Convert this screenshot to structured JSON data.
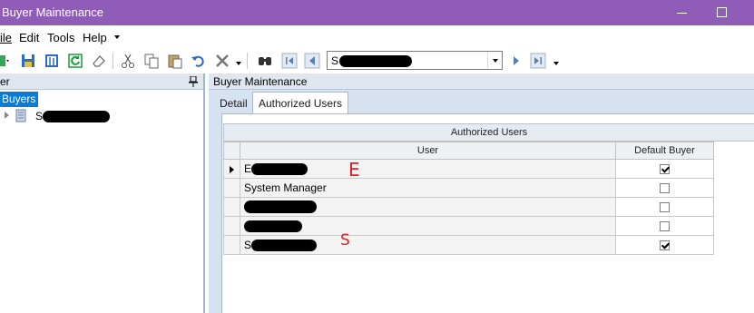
{
  "window": {
    "title": "Buyer Maintenance",
    "minimize_icon": "minimize-icon",
    "maximize_icon": "maximize-icon"
  },
  "menu": {
    "items": [
      {
        "label": "ile",
        "mnemonic": "F"
      },
      {
        "label": "Edit"
      },
      {
        "label": "Tools"
      },
      {
        "label": "Help"
      }
    ]
  },
  "toolbar": {
    "icons": [
      "new-icon",
      "save-icon",
      "attach-icon",
      "refresh-icon",
      "clear-icon",
      "cut-icon",
      "copy-icon",
      "paste-icon",
      "undo-icon",
      "delete-icon",
      "find-icon",
      "first-record-icon",
      "previous-record-icon",
      "next-record-icon",
      "last-record-icon"
    ],
    "navigator_value": "S"
  },
  "tree_panel": {
    "header": "er",
    "root_label": "Buyers",
    "node_label_visible": "S"
  },
  "main_panel": {
    "header": "Buyer Maintenance",
    "tabs": [
      {
        "label": "Detail"
      },
      {
        "label": "Authorized Users",
        "active": true
      }
    ],
    "grid": {
      "caption": "Authorized Users",
      "columns": [
        "User",
        "Default Buyer"
      ],
      "rows": [
        {
          "user": "E",
          "default_buyer": true,
          "selected": true,
          "annotation": "E"
        },
        {
          "user": "System Manager",
          "default_buyer": false
        },
        {
          "user": "",
          "default_buyer": false
        },
        {
          "user": "",
          "default_buyer": false
        },
        {
          "user": "S",
          "default_buyer": true,
          "annotation": "S"
        }
      ]
    }
  },
  "colors": {
    "title_bar": "#8f5cb8",
    "selection": "#0a7bd6",
    "annotation": "#e02020",
    "panel_bg": "#d7e2f0"
  }
}
